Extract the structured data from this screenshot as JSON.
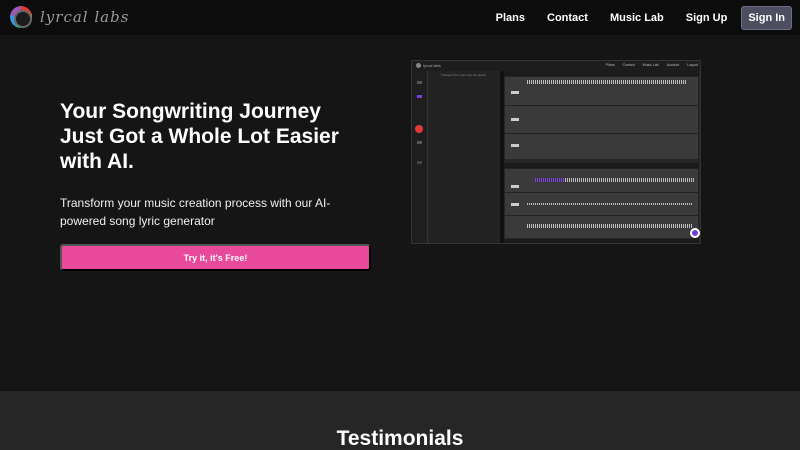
{
  "nav": {
    "logo_text": "lyrcal labs",
    "links": [
      "Plans",
      "Contact",
      "Music Lab",
      "Sign Up"
    ],
    "signin": "Sign In"
  },
  "hero": {
    "title": "Your Songwriting Journey Just Got a Whole Lot Easier with AI.",
    "subtitle": "Transform your music creation process with our AI-powered song lyric generator",
    "cta": "Try it, it's Free!"
  },
  "preview": {
    "brand": "lyrcal labs",
    "nav": [
      "Plans",
      "Contact",
      "Music Lab",
      "Account",
      "Logout"
    ],
    "panel_text": "Transport the lyrics into the doctor"
  },
  "section": {
    "testimonials": "Testimonials"
  },
  "colors": {
    "cta": "#e8499a",
    "signin_bg": "#4d4f61",
    "page_bg": "#151515"
  }
}
